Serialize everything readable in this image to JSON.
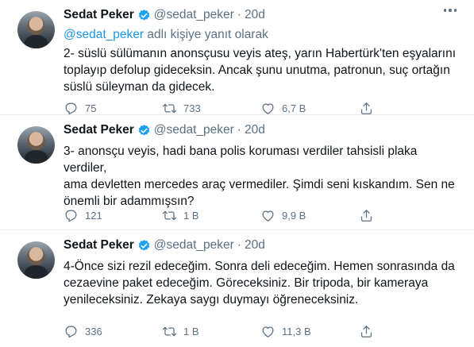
{
  "tweets": [
    {
      "name": "Sedat Peker",
      "handle": "@sedat_peker",
      "separator": "·",
      "time": "20d",
      "reply_mention": "@sedat_peker",
      "reply_suffix": " adlı kişiye yanıt olarak",
      "text": "2- süslü sülümanın anonsçusu veyis ateş, yarın Habertürk'ten eşyalarını\ntoplayıp defolup gideceksin. Ancak şunu unutma, patronun, suç ortağın\nsüslü süleyman da gidecek.",
      "replies": "75",
      "retweets": "733",
      "likes": "6,7 B"
    },
    {
      "name": "Sedat Peker",
      "handle": "@sedat_peker",
      "separator": "·",
      "time": "20d",
      "text": "3- anonsçu veyis, hadi bana polis koruması verdiler tahsisli plaka verdiler,\nama devletten mercedes araç vermediler. Şimdi seni kıskandım. Sen ne\nönemli bir adammışsın?",
      "replies": "121",
      "retweets": "1 B",
      "likes": "9,9 B"
    },
    {
      "name": "Sedat Peker",
      "handle": "@sedat_peker",
      "separator": "·",
      "time": "20d",
      "text": "4-Önce sizi rezil edeceğim. Sonra deli edeceğim. Hemen sonrasında da\ncezaevine paket edeceğim. Göreceksiniz. Bir tripoda, bir kameraya\nyenileceksiniz. Zekaya saygı duymayı öğreneceksiniz.",
      "replies": "336",
      "retweets": "1 B",
      "likes": "11,3 B"
    }
  ],
  "icons": {
    "verified": "verified-badge-icon",
    "reply": "reply-icon",
    "retweet": "retweet-icon",
    "like": "heart-icon",
    "share": "share-icon",
    "more": "more-icon"
  },
  "colors": {
    "accent": "#1da1f2",
    "mention": "#1b95e0",
    "secondary": "#5b7083",
    "text": "#0f1419"
  }
}
